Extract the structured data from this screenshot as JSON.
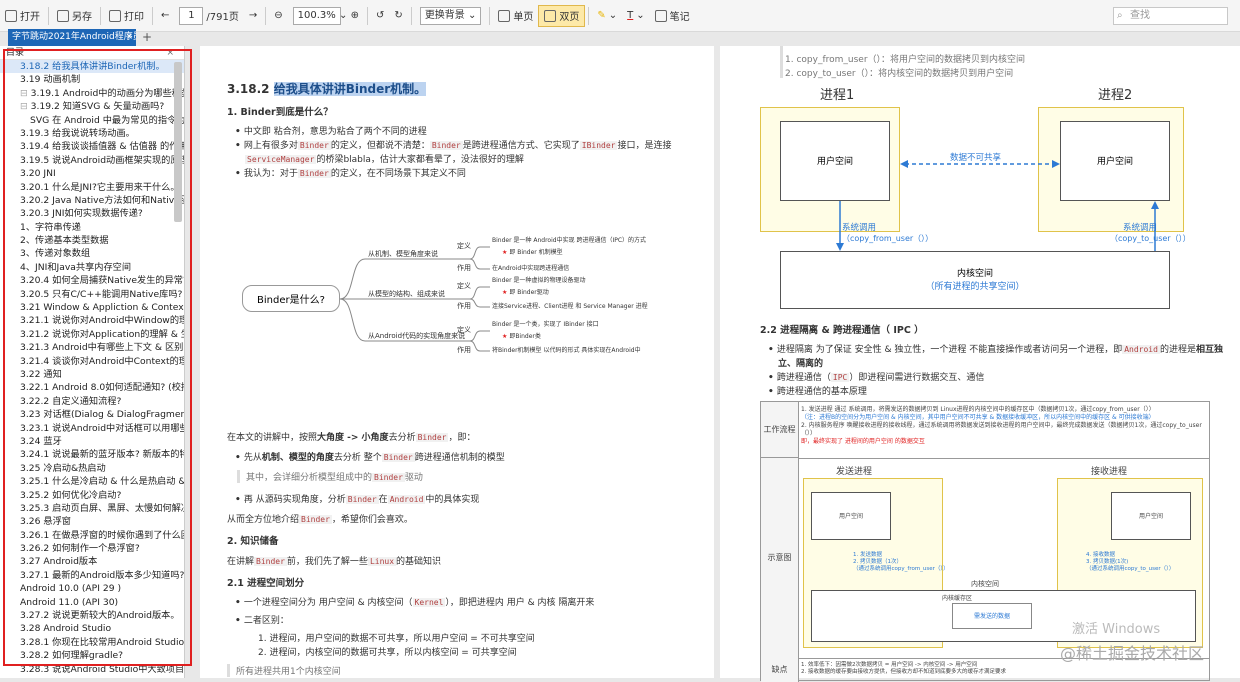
{
  "toolbar": {
    "open": "打开",
    "saveas": "另存",
    "print": "打印",
    "page_current": "1",
    "page_total": "/791页",
    "zoom": "100.3%",
    "bg": "更换背景",
    "single": "单页",
    "double": "双页",
    "note": "笔记",
    "search_placeholder": "查找"
  },
  "tab": {
    "title": "字节跳动2021年Android程序员..",
    "close": "×",
    "add": "+"
  },
  "sidebar": {
    "title": "目录",
    "close": "×",
    "items": [
      "3.18.2 给我具体讲讲Binder机制。",
      "3.19 动画机制",
      "3.19.1 Android中的动画分为哪些种类 &",
      "3.19.2 知道SVG & 矢量动画吗?",
      "SVG 在 Android 中最为常见的指令为",
      "3.19.3 给我说说转场动画。",
      "3.19.4 给我谈谈插值器 & 估值器 的作用",
      "3.19.5 说说Android动画框架实现的原理",
      "3.20 JNI",
      "3.20.1 什么是JNI?它主要用来干什么。",
      "3.20.2 Java Native方法如何和Native函数",
      "3.20.3 JNI如何实现数据传递?",
      "1、字符串传递",
      "2、传递基本类型数据",
      "3、传递对象数组",
      "4、JNI和Java共享内存空间",
      "3.20.4 如何全局捕获Native发生的异常?",
      "3.20.5 只有C/C++能调用Native库吗?",
      "3.21 Window & Appliction & Context",
      "3.21.1 说说你对Android中Window的理解",
      "3.21.2 说说你对Application的理解 & 生",
      "3.21.3 Android中有哪些上下文 & 区别 &",
      "3.21.4 谈谈你对Android中Context的理解",
      "3.22 通知",
      "3.22.1 Android 8.0如何适配通知? (校招",
      "3.22.2 自定义通知流程?",
      "3.23 对话框(Dialog & DialogFragment",
      "3.23.1 说说Android中对话框可以用哪些",
      "3.24 蓝牙",
      "3.24.1 说说最新的蓝牙版本? 新版本的特",
      "3.25 冷启动&热启动",
      "3.25.1 什么是冷启动 & 什么是热启动 &",
      "3.25.2 如何优化冷启动?",
      "3.25.3 启动页白屏、黑屏、太慢如何解决",
      "3.26 悬浮窗",
      "3.26.1 在做悬浮窗的时候你遇到了什么困",
      "3.26.2 如何制作一个悬浮窗?",
      "3.27 Android版本",
      "3.27.1 最新的Android版本多少知道吗?:",
      "Android 10.0  (API 29 )",
      "Android 11.0  (API 30)",
      "3.27.2 说说更新较大的Android版本。",
      "3.28 Android Studio",
      "3.28.1 你现在比较常用Android Studio那",
      "3.28.2 如何理解gradle?",
      "3.28.3 说说Android Studio中大致项目结"
    ]
  },
  "left_page": {
    "title_num": "3.18.2",
    "title_text": "给我具体讲讲Binder机制。",
    "h1": "1. Binder到底是什么？",
    "b1": "中文即 粘合剂，意思为粘合了两个不同的进程",
    "b2a": "网上有很多对",
    "b2code1": "Binder",
    "b2b": "的定义，但都说不清楚：",
    "b2code2": "Binder",
    "b2c": "是跨进程通信方式、它实现了",
    "b2code3": "IBinder",
    "b2d": "接口，是连接",
    "b2code4": "ServiceManager",
    "b2e": "的桥梁blabla，估计大家都看晕了，没法很好的理解",
    "b3a": "我认为：对于",
    "b3code": "Binder",
    "b3b": "的定义，在不同场景下其定义不同",
    "mind_root": "Binder是什么?",
    "mind_b1": "从机制、模型角度来说",
    "mind_b2": "从模型的结构、组成来说",
    "mind_b3": "从Android代码的实现角度来说",
    "mind_def": "定义",
    "mind_use": "作用",
    "mind_l1": "Binder 是一种 Android中实现 跨进程通信（IPC）的方式",
    "mind_l2": "即 Binder 机制模型",
    "mind_l3": "在Android中实现跨进程通信",
    "mind_l4": "Binder 是一种虚拟的物理设备驱动",
    "mind_l5": "即 Binder驱动",
    "mind_l6": "连接Service进程、Client进程 和 Service Manager 进程",
    "mind_l7": "Binder 是一个类，实现了 IBinder 接口",
    "mind_l8": "即Binder类",
    "mind_l9": "将Binder机制模型 以代码的形式 具体实现在Android中",
    "p1a": "在本文的讲解中，按照",
    "p1b": "大角度 -> 小角度",
    "p1c": "去分析",
    "p1code": "Binder",
    "p1d": "，即：",
    "b4a": "先从",
    "b4b": "机制、模型的角度",
    "b4c": "去分析 整个",
    "b4code": "Binder",
    "b4d": "跨进程通信机制的模型",
    "q1": "其中，会详细分析模型组成中的",
    "q1code": "Binder",
    "q1b": "驱动",
    "b5a": "再 从源码实现角度，分析",
    "b5code1": "Binder",
    "b5b": "在",
    "b5code2": "Android",
    "b5c": "中的具体实现",
    "p2a": "从而全方位地介绍",
    "p2code": "Binder",
    "p2b": "，希望你们会喜欢。",
    "h2": "2. 知识储备",
    "p3a": "在讲解",
    "p3code1": "Binder",
    "p3b": "前，我们先了解一些",
    "p3code2": "Linux",
    "p3c": "的基础知识",
    "h21": "2.1 进程空间划分",
    "b6a": "一个进程空间分为 用户空间 & 内核空间（",
    "b6code": "Kernel",
    "b6b": "），即把进程内 用户 & 内核 隔离开来",
    "b7": "二者区别：",
    "n1": "1. 进程间，用户空间的数据不可共享，所以用户空间 = 不可共享空间",
    "n2": "2. 进程间，内核空间的数据可共享，所以内核空间 = 可共享空间",
    "q2": "所有进程共用1个内核空间"
  },
  "right_page": {
    "r1": "1. copy_from_user（）：将用户空间的数据拷贝到内核空间",
    "r2": "2. copy_to_user（）：将内核空间的数据拷贝到用户空间",
    "proc1": "进程1",
    "proc2": "进程2",
    "user_space": "用户空间",
    "no_share": "数据不可共享",
    "syscall": "系统调用",
    "cfu": "（copy_from_user（））",
    "ctu": "（copy_to_user（））",
    "kernel": "内核空间",
    "kernel_sub": "（所有进程的共享空间）",
    "h22": "2.2 进程隔离 & 跨进程通信（ IPC ）",
    "b1a": "进程隔离 为了保证 安全性 & 独立性，一个进程 不能直接操作或者访问另一个进程，即",
    "b1code": "Android",
    "b1b": "的进程是",
    "b1c": "相互独",
    "b1d": "立、隔离的",
    "b2a": "跨进程通信（",
    "b2code": "IPC",
    "b2b": "）即进程间需进行数据交互、通信",
    "b3": "跨进程通信的基本原理",
    "t_flow": "工作流程",
    "t_flow_1": "1. 发送进程 通过 系统调用，将需发送的数据拷贝到 Linux进程的内核空间中的缓存区中（数据拷贝1次，通过copy_from_user（））",
    "t_flow_1b": "（注：进程B的空间分为用户空间 & 内核空间，其中用户空间不可共享 & 数据接收缓冲区，所以内核空间中的缓存区 & 可供接收端）",
    "t_flow_2": "2. 内核服务程序 唤醒接收进程的接收线程，通过系统调用将数据发送到接收进程的用户空间中，最终完成数据发送（数据拷贝1次，通过copy_to_user（））",
    "t_flow_3": "即，最终实现了 进程间的用户空间 的数据交互",
    "t_diag": "示意图",
    "send": "发送进程",
    "recv": "接收进程",
    "sm1": "1. 发送数据",
    "sm2": "2. 拷贝数据（1次）",
    "sm3": "（通过系统调用copy_from_user（））",
    "rm1": "4. 接收数据",
    "rm2": "3. 拷贝数据(1次)",
    "rm3": "（通过系统调用copy_to_user（））",
    "kspace": "内核空间",
    "kcache": "内核缓存区",
    "kdata": "需发送的数据",
    "t_weak": "缺点",
    "t_weak_1": "1. 效率低下：因需做2次数据拷贝 = 用户空间 -> 内核空间 -> 用户空间",
    "t_weak_2": "2. 接收数据的缓存要由接收方提供，但接收方却不知道到底要多大的缓存才满足要求"
  },
  "watermarks": {
    "w1": "激活 Windows",
    "w2": "@稀土掘金技术社区"
  }
}
